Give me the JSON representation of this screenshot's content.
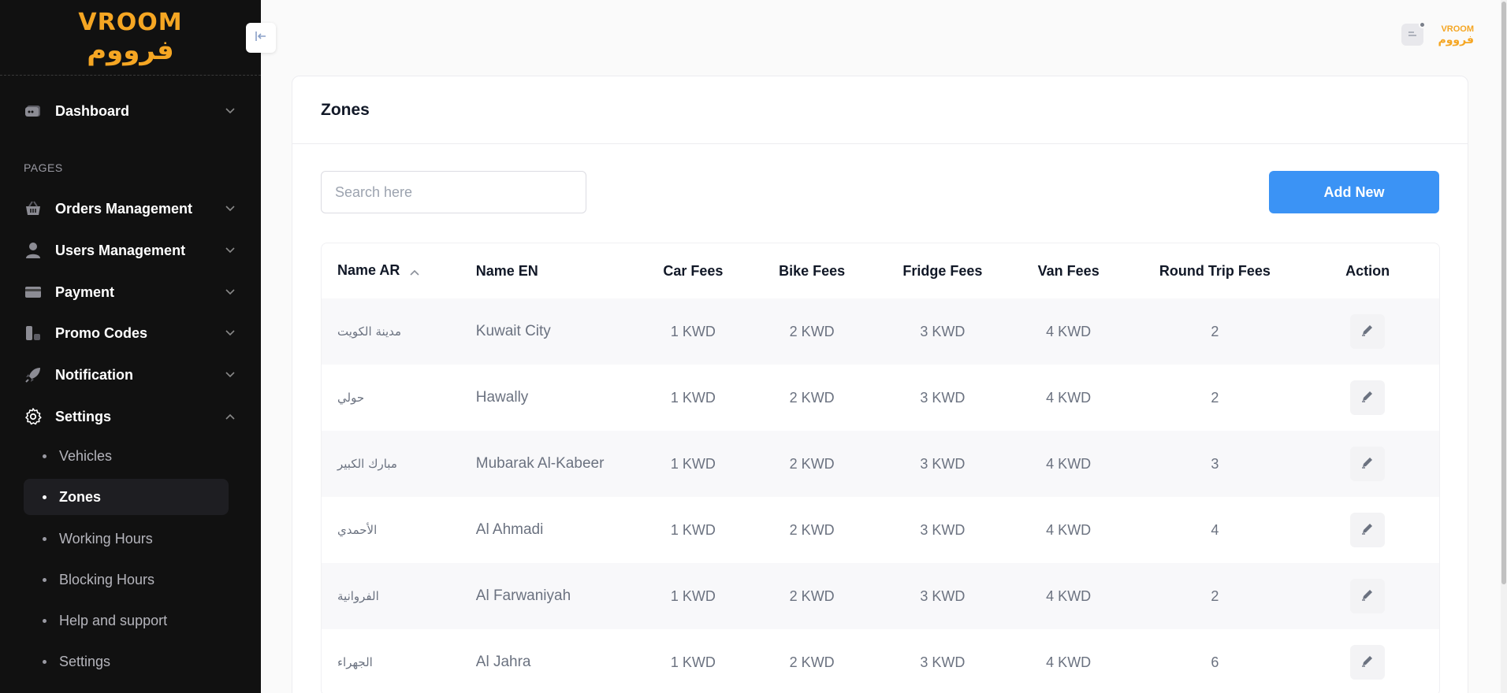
{
  "brand": {
    "logo_en": "VROOM",
    "logo_ar": "فرووم",
    "accent_color": "#f5a623"
  },
  "sidebar": {
    "dashboard_label": "Dashboard",
    "section_title": "PAGES",
    "items": [
      {
        "label": "Orders Management",
        "icon": "basket-icon"
      },
      {
        "label": "Users Management",
        "icon": "user-icon"
      },
      {
        "label": "Payment",
        "icon": "credit-card-icon"
      },
      {
        "label": "Promo Codes",
        "icon": "promo-icon"
      },
      {
        "label": "Notification",
        "icon": "rocket-icon"
      },
      {
        "label": "Settings",
        "icon": "gear-icon"
      }
    ],
    "settings_sub": [
      {
        "label": "Vehicles"
      },
      {
        "label": "Zones"
      },
      {
        "label": "Working Hours"
      },
      {
        "label": "Blocking Hours"
      },
      {
        "label": "Help and support"
      },
      {
        "label": "Settings"
      }
    ]
  },
  "card": {
    "title": "Zones",
    "search_placeholder": "Search here",
    "add_button": "Add New",
    "add_button_color": "#3b93f5"
  },
  "table": {
    "headers": {
      "name_ar": "Name AR",
      "name_en": "Name EN",
      "car_fees": "Car Fees",
      "bike_fees": "Bike Fees",
      "fridge_fees": "Fridge Fees",
      "van_fees": "Van Fees",
      "round_trip_fees": "Round Trip Fees",
      "action": "Action"
    },
    "rows": [
      {
        "name_ar": "مدينة الكويت",
        "name_en": "Kuwait City",
        "car": "1 KWD",
        "bike": "2 KWD",
        "fridge": "3 KWD",
        "van": "4 KWD",
        "round_trip": "2"
      },
      {
        "name_ar": "حولي",
        "name_en": "Hawally",
        "car": "1 KWD",
        "bike": "2 KWD",
        "fridge": "3 KWD",
        "van": "4 KWD",
        "round_trip": "2"
      },
      {
        "name_ar": "مبارك الكبير",
        "name_en": "Mubarak Al-Kabeer",
        "car": "1 KWD",
        "bike": "2 KWD",
        "fridge": "3 KWD",
        "van": "4 KWD",
        "round_trip": "3"
      },
      {
        "name_ar": "الأحمدي",
        "name_en": "Al Ahmadi",
        "car": "1 KWD",
        "bike": "2 KWD",
        "fridge": "3 KWD",
        "van": "4 KWD",
        "round_trip": "4"
      },
      {
        "name_ar": "الفروانية",
        "name_en": "Al Farwaniyah",
        "car": "1 KWD",
        "bike": "2 KWD",
        "fridge": "3 KWD",
        "van": "4 KWD",
        "round_trip": "2"
      },
      {
        "name_ar": "الجهراء",
        "name_en": "Al Jahra",
        "car": "1 KWD",
        "bike": "2 KWD",
        "fridge": "3 KWD",
        "van": "4 KWD",
        "round_trip": "6"
      }
    ]
  }
}
